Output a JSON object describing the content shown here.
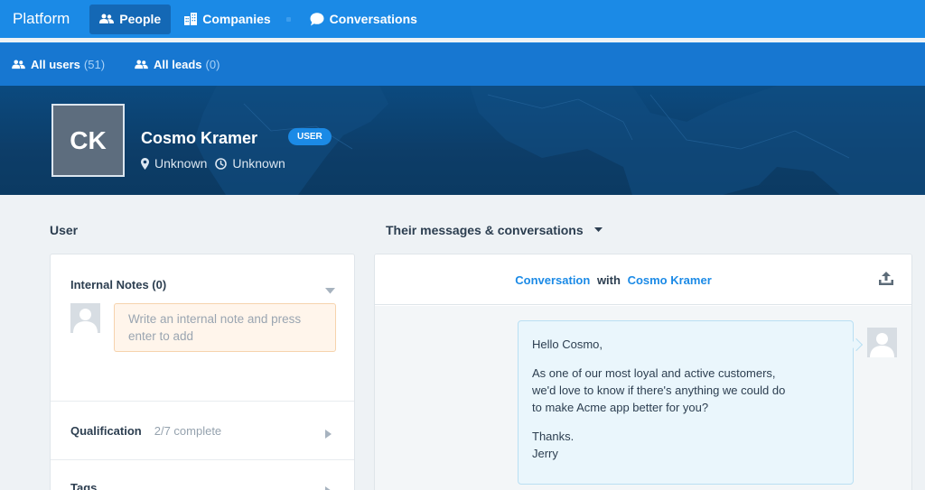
{
  "nav": {
    "brand": "Platform",
    "items": [
      {
        "label": "People",
        "icon": "people-icon",
        "active": true
      },
      {
        "label": "Companies",
        "icon": "building-icon",
        "active": false
      },
      {
        "label": "Conversations",
        "icon": "chat-bubble-icon",
        "active": false
      }
    ]
  },
  "subnav": {
    "items": [
      {
        "label": "All users",
        "count": "(51)",
        "icon": "people-icon"
      },
      {
        "label": "All leads",
        "count": "(0)",
        "icon": "people-icon"
      }
    ]
  },
  "profile": {
    "initials": "CK",
    "name": "Cosmo Kramer",
    "badge": "USER",
    "location": "Unknown",
    "local_time": "Unknown"
  },
  "sections": {
    "user": "User",
    "messages": "Their messages & conversations"
  },
  "notes": {
    "title": "Internal Notes (0)",
    "placeholder_line1": "Write an internal note and press",
    "placeholder_line2": "enter to add"
  },
  "qualification": {
    "label": "Qualification",
    "value": "2/7 complete"
  },
  "tags": {
    "label": "Tags"
  },
  "conversation": {
    "title_link": "Conversation",
    "title_with": "with",
    "title_name": "Cosmo Kramer",
    "message": {
      "greeting": "Hello Cosmo,",
      "body_line1": "As one of our most loyal and active customers,",
      "body_line2": "we'd love to know if there's anything we could do",
      "body_line3": "to make Acme app better for you?",
      "signoff": "Thanks.",
      "sender": "Jerry"
    }
  },
  "colors": {
    "nav_bg": "#1b8ae6",
    "subnav_bg": "#1777d1",
    "banner_bg": "#0d3d68",
    "accent": "#1b8ae6",
    "note_bg": "#fff5eb"
  }
}
